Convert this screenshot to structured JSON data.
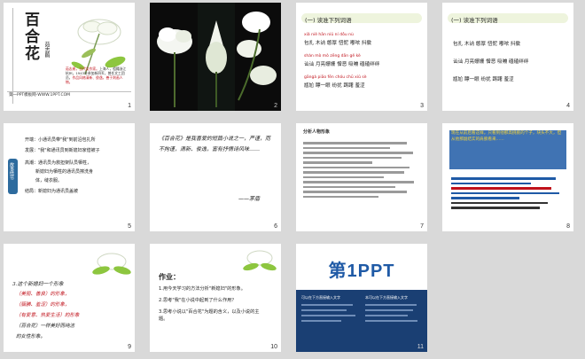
{
  "slides": [
    {
      "num": "1",
      "title": "百合花",
      "author": "茹志鹃",
      "footer": "第一PPT模板网-WWW.1PPT.COM"
    },
    {
      "num": "2"
    },
    {
      "num": "3",
      "header": "(一) 读准下列词语",
      "rows": [
        {
          "pinyin": "xiǎ   niè  hān  niǔ ní  dǒu   nù",
          "words": "包扎  木讷  憨厚  忸怩  嘟哝  抖擞"
        },
        {
          "pinyin": "shàn  mò  mò  zēng  dān  gě  kè",
          "words": "讪讪  月亮姗姗  憎恶  吸嘣  磕磕绊绊"
        },
        {
          "pinyin": "gāngà  piāo  fēn  chóu chū  xiǔ  sè",
          "words": "尴尬  瞟一眼  纷扰  踌躇  羞涩"
        }
      ]
    },
    {
      "num": "4",
      "header": "(一) 读准下列词语",
      "rows": [
        "包扎  木讷  憨厚  忸怩  嘟哝  抖擞",
        "讪讪  月亮姗姗  憎恶  吸嘣  磕磕绊绊",
        "尴尬  瞟一眼  纷扰  踌躇  羞涩"
      ]
    },
    {
      "num": "5",
      "tab": "故事情节",
      "lines": [
        "开端：小通讯员带\"我\"到前沿包扎所",
        "发展：\"我\"和通讯员到新媳妇家借被子",
        "高潮：通讯员为救担架队员牺牲，",
        "新媳妇为牺牲的通讯员擦洗身",
        "体，缝衣服。",
        "结局：新媳妇为通讯员盖被"
      ]
    },
    {
      "num": "6",
      "quote": "《百合花》是我喜爱的短篇小说之一，严谨，而不拘谨，清新、俊逸，富有抒情诗风味……",
      "sign": "——茅盾"
    },
    {
      "num": "7",
      "title": "分析人物形象"
    },
    {
      "num": "8",
      "text": "现在从前后看这样，只看到他那高挑挑的个子，块头不大，但从他那副结实的肩膀看来……"
    },
    {
      "num": "9",
      "lines": [
        "3.这个新媳妇一个形象",
        "（美丽、善良）的形象，",
        "（腼腆、羞涩）的形象，",
        "（有爱意、热爱生活）的形象",
        "（百合花）一样美好而纯洁",
        "的女性形象。"
      ]
    },
    {
      "num": "10",
      "header": "作业：",
      "items": [
        "1.用今天学习的方法分析\"新媳妇\"的形象。",
        "2.思考\"我\"在小说中起到了什么作用？",
        "3.思考小说以\"百合花\"为题的含义，以及小说的主题。"
      ]
    },
    {
      "num": "11",
      "logo": "第1PPT",
      "box1": "可以在下方直接输入文字",
      "box2": "本可以在下方直接输入文字"
    }
  ]
}
